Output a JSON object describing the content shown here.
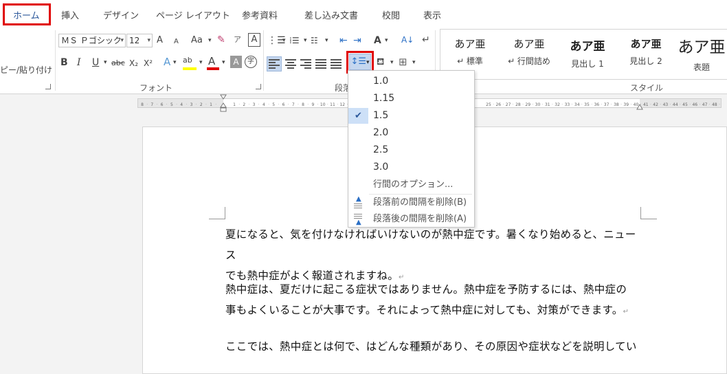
{
  "tabs": [
    {
      "label": "ホーム",
      "active": true
    },
    {
      "label": "挿入"
    },
    {
      "label": "デザイン"
    },
    {
      "label": "ページ レイアウト"
    },
    {
      "label": "参考資料"
    },
    {
      "label": "差し込み文書"
    },
    {
      "label": "校閲"
    },
    {
      "label": "表示"
    }
  ],
  "clipboard": {
    "paste_label": "ピー/貼り付け"
  },
  "font": {
    "name": "ＭＳ Ｐゴシック",
    "size": "12",
    "grow_label": "A",
    "shrink_label": "A",
    "case_label": "Aa",
    "bold": "B",
    "italic": "I",
    "underline": "U",
    "strike": "abc",
    "subscript": "X₂",
    "superscript": "X²",
    "group_label": "フォント"
  },
  "paragraph": {
    "group_label": "段落"
  },
  "styles": {
    "group_label": "スタイル",
    "items": [
      {
        "sample": "あア亜",
        "name": "↵ 標準"
      },
      {
        "sample": "あア亜",
        "name": "↵ 行間詰め"
      },
      {
        "sample": "あア亜",
        "name": "見出し 1"
      },
      {
        "sample": "あア亜",
        "name": "見出し 2"
      },
      {
        "sample": "あア亜",
        "name": "表題"
      }
    ]
  },
  "ruler": {
    "left_numbers": [
      "8",
      "7",
      "6",
      "5",
      "4",
      "3",
      "2",
      "1"
    ],
    "right_numbers": [
      "1",
      "2",
      "3",
      "4",
      "5",
      "6",
      "7",
      "8",
      "9",
      "10",
      "11",
      "12"
    ],
    "far_numbers": [
      "25",
      "26",
      "27",
      "28",
      "29",
      "30",
      "31",
      "32",
      "33",
      "34",
      "35",
      "36",
      "37",
      "38",
      "39",
      "40",
      "41",
      "42",
      "43",
      "44",
      "45",
      "46",
      "47",
      "48"
    ]
  },
  "line_spacing_menu": {
    "options": [
      "1.0",
      "1.15",
      "1.5",
      "2.0",
      "2.5",
      "3.0"
    ],
    "selected": "1.5",
    "more_options": "行間のオプション...",
    "remove_before": "段落前の間隔を削除(B)",
    "remove_after": "段落後の間隔を削除(A)"
  },
  "document": {
    "paragraphs": [
      [
        "夏になると、気を付けなければいけないのが熱中症です。暑くなり始めると、ニュース",
        "でも熱中症がよく報道されますね。"
      ],
      [
        "熱中症は、夏だけに起こる症状ではありません。熱中症を予防するには、熱中症の",
        "事もよくいることが大事です。それによって熱中症に対しても、対策ができます。"
      ],
      [
        "ここでは、熱中症とは何で、はどんな種類があり、その原因や症状などを説明してい"
      ]
    ]
  },
  "colors": {
    "accent": "#2b579a",
    "highlight_box": "#e00000",
    "font_color_red": "#e00000",
    "highlight_yellow": "#ffff00"
  }
}
